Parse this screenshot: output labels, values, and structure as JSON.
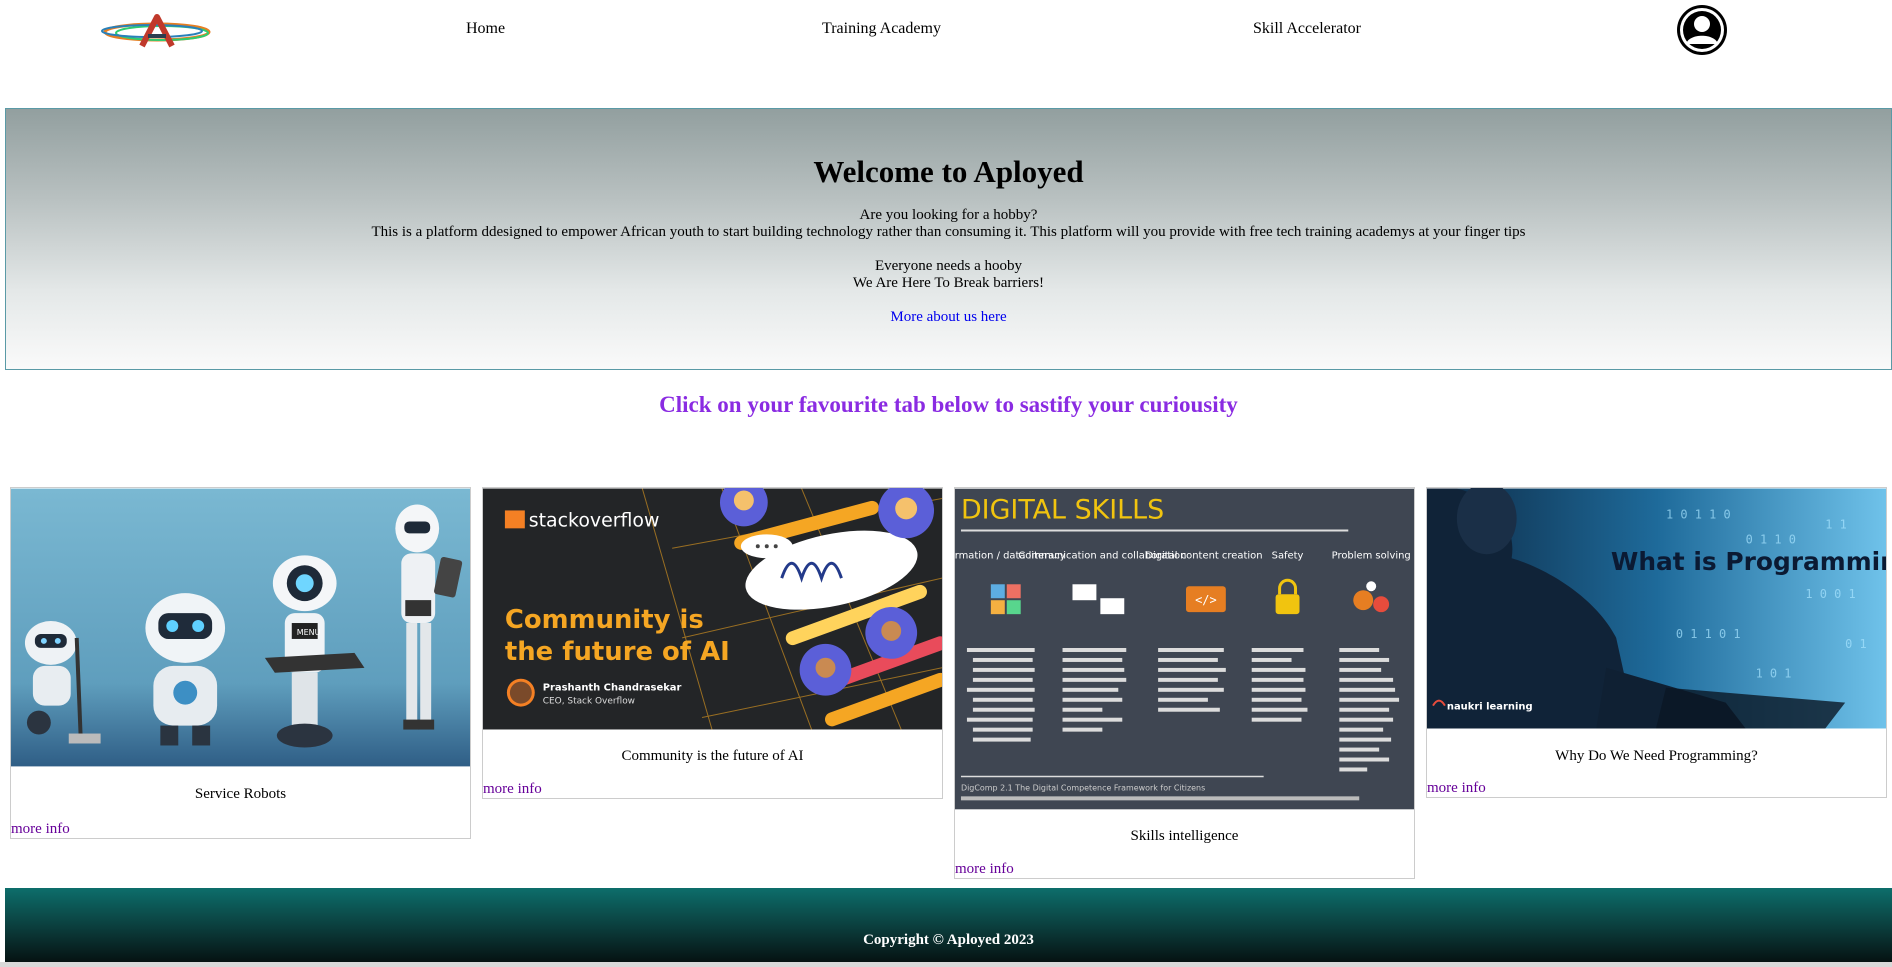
{
  "nav": {
    "links": [
      "Home",
      "Training Academy",
      "Skill Accelerator"
    ]
  },
  "hero": {
    "title": "Welcome to Aployed",
    "question": "Are you looking for a hobby?",
    "description": "This is a platform ddesigned to empower African youth to start building technology rather than consuming it. This platform will you provide with free tech training academys at your finger tips",
    "line1": "Everyone needs a hooby",
    "line2": "We Are Here To Break barriers!",
    "link": "More about us here"
  },
  "tagline": "Click on your favourite tab below to sastify your curiousity",
  "cards": [
    {
      "title": "Service Robots",
      "more": "more info"
    },
    {
      "title": "Community is the future of AI",
      "more": "more info",
      "image_text": {
        "brand": "stackoverflow",
        "headline1": "Community is",
        "headline2": "the future of AI",
        "person": "Prashanth Chandrasekar",
        "role": "CEO, Stack Overflow"
      }
    },
    {
      "title": "Skills intelligence",
      "more": "more info",
      "image_text": {
        "heading": "DIGITAL SKILLS",
        "columns": [
          {
            "name": "Information / data literacy",
            "items": "Browsing, searching and filtering data, information and digital content · Evaluating data, information and digital content · Managing data, information and digital content"
          },
          {
            "name": "Communication and collaboration",
            "items": "Interacting via ICT · Sharing via ICT · Engaging in citizenship via ICT · Collaborating via ICT · Netiquette · Managing digital identity"
          },
          {
            "name": "Digital content creation",
            "items": "Developing digital content · Integrating and re-elaborating digital content · Copyright and licences · Programming"
          },
          {
            "name": "Safety",
            "items": "Protecting devices · Protecting personal data and privacy · Protecting health and well-being · Protecting the environment"
          },
          {
            "name": "Problem solving",
            "items": "Solving technical problems · Identifying needs and technological responses · Creatively using digital technologies · Identifying digital competence gaps"
          }
        ],
        "source": "DigComp 2.1 The Digital Competence Framework for Citizens"
      }
    },
    {
      "title": "Why Do We Need Programming?",
      "more": "more info",
      "image_text": {
        "headline": "What is Programming?",
        "brand": "naukri learning"
      }
    }
  ],
  "footer": {
    "copyright": "Copyright © Aployed 2023"
  },
  "colors": {
    "accent_purple": "#8a2be2",
    "link_blue": "#0000ee",
    "visited_purple": "#660099",
    "footer_teal": "#0d6e6b"
  }
}
